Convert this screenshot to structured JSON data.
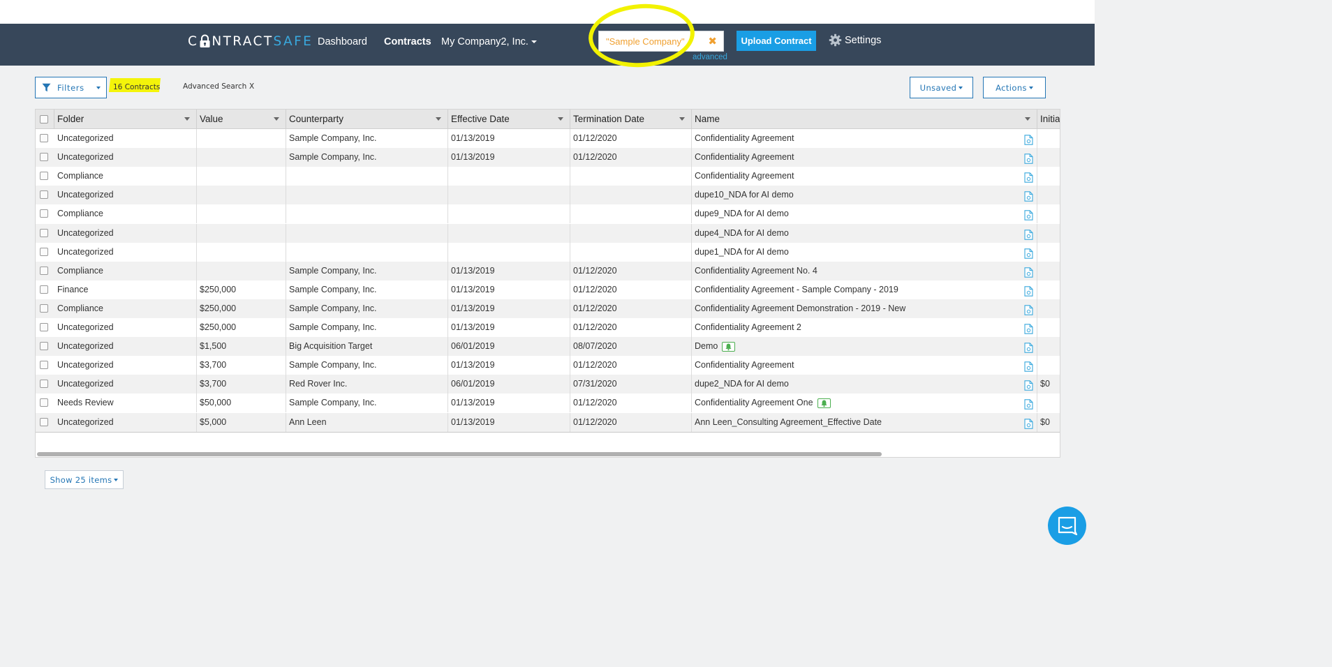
{
  "nav": {
    "logo_part1": "C",
    "logo_part2": "NTRACT",
    "logo_part3": "SAFE",
    "dashboard": "Dashboard",
    "contracts": "Contracts",
    "company": "My Company2, Inc.",
    "search_value": "\"Sample Company\"",
    "advanced": "advanced",
    "upload": "Upload Contract",
    "settings": "Settings",
    "search_accent": "#f0a030",
    "brand_color": "#37475a",
    "upload_color": "#1a9ee5"
  },
  "toolbar": {
    "filters": "Filters",
    "count": "16 Contracts",
    "adv_search": "Advanced Search",
    "adv_close": "X",
    "unsaved": "Unsaved",
    "actions": "Actions"
  },
  "table": {
    "columns": [
      "Folder",
      "Value",
      "Counterparty",
      "Effective Date",
      "Termination Date",
      "Name",
      "Initial"
    ],
    "rows": [
      {
        "folder": "Uncategorized",
        "value": "",
        "counterparty": "Sample Company, Inc.",
        "effective": "01/13/2019",
        "termination": "01/12/2020",
        "name": "Confidentiality Agreement",
        "bell": false,
        "initial": ""
      },
      {
        "folder": "Uncategorized",
        "value": "",
        "counterparty": "Sample Company, Inc.",
        "effective": "01/13/2019",
        "termination": "01/12/2020",
        "name": "Confidentiality Agreement",
        "bell": false,
        "initial": ""
      },
      {
        "folder": "Compliance",
        "value": "",
        "counterparty": "",
        "effective": "",
        "termination": "",
        "name": "Confidentiality Agreement",
        "bell": false,
        "initial": ""
      },
      {
        "folder": "Uncategorized",
        "value": "",
        "counterparty": "",
        "effective": "",
        "termination": "",
        "name": "dupe10_NDA for AI demo",
        "bell": false,
        "initial": ""
      },
      {
        "folder": "Compliance",
        "value": "",
        "counterparty": "",
        "effective": "",
        "termination": "",
        "name": "dupe9_NDA for AI demo",
        "bell": false,
        "initial": ""
      },
      {
        "folder": "Uncategorized",
        "value": "",
        "counterparty": "",
        "effective": "",
        "termination": "",
        "name": "dupe4_NDA for AI demo",
        "bell": false,
        "initial": ""
      },
      {
        "folder": "Uncategorized",
        "value": "",
        "counterparty": "",
        "effective": "",
        "termination": "",
        "name": "dupe1_NDA for AI demo",
        "bell": false,
        "initial": ""
      },
      {
        "folder": "Compliance",
        "value": "",
        "counterparty": "Sample Company, Inc.",
        "effective": "01/13/2019",
        "termination": "01/12/2020",
        "name": "Confidentiality Agreement No. 4",
        "bell": false,
        "initial": ""
      },
      {
        "folder": "Finance",
        "value": "$250,000",
        "counterparty": "Sample Company, Inc.",
        "effective": "01/13/2019",
        "termination": "01/12/2020",
        "name": "Confidentiality Agreement - Sample Company - 2019",
        "bell": false,
        "initial": ""
      },
      {
        "folder": "Compliance",
        "value": "$250,000",
        "counterparty": "Sample Company, Inc.",
        "effective": "01/13/2019",
        "termination": "01/12/2020",
        "name": "Confidentiality Agreement Demonstration - 2019 - New",
        "bell": false,
        "initial": ""
      },
      {
        "folder": "Uncategorized",
        "value": "$250,000",
        "counterparty": "Sample Company, Inc.",
        "effective": "01/13/2019",
        "termination": "01/12/2020",
        "name": "Confidentiality Agreement 2",
        "bell": false,
        "initial": ""
      },
      {
        "folder": "Uncategorized",
        "value": "$1,500",
        "counterparty": "Big Acquisition Target",
        "effective": "06/01/2019",
        "termination": "08/07/2020",
        "name": "Demo",
        "bell": true,
        "initial": ""
      },
      {
        "folder": "Uncategorized",
        "value": "$3,700",
        "counterparty": "Sample Company, Inc.",
        "effective": "01/13/2019",
        "termination": "01/12/2020",
        "name": "Confidentiality Agreement",
        "bell": false,
        "initial": ""
      },
      {
        "folder": "Uncategorized",
        "value": "$3,700",
        "counterparty": "Red Rover Inc.",
        "effective": "06/01/2019",
        "termination": "07/31/2020",
        "name": "dupe2_NDA for AI demo",
        "bell": false,
        "initial": "$0"
      },
      {
        "folder": "Needs Review",
        "value": "$50,000",
        "counterparty": "Sample Company, Inc.",
        "effective": "01/13/2019",
        "termination": "01/12/2020",
        "name": "Confidentiality Agreement One",
        "bell": true,
        "initial": ""
      },
      {
        "folder": "Uncategorized",
        "value": "$5,000",
        "counterparty": "Ann Leen",
        "effective": "01/13/2019",
        "termination": "01/12/2020",
        "name": "Ann Leen_Consulting Agreement_Effective Date",
        "bell": false,
        "initial": "$0"
      }
    ]
  },
  "footer": {
    "show_items": "Show 25 items"
  },
  "icons": {
    "filter": "filter-icon",
    "settings": "gear-icon",
    "document": "document-icon",
    "bell": "bell-icon",
    "chat": "chat-icon",
    "lock": "lock-icon"
  }
}
